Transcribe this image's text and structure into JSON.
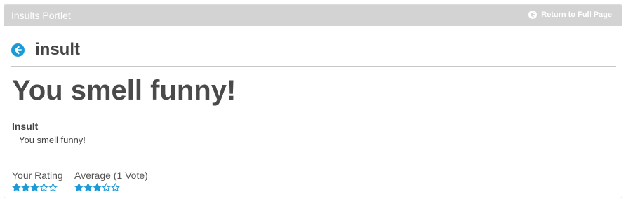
{
  "portlet": {
    "title": "Insults Portlet",
    "return_label": "Return to Full Page"
  },
  "header": {
    "title": "insult"
  },
  "entry": {
    "heading": "You smell funny!",
    "field_label": "Insult",
    "field_value": "You smell funny!"
  },
  "ratings": {
    "your_rating_label": "Your Rating",
    "your_rating_value": 3,
    "average_label": "Average (1 Vote)",
    "average_value": 3,
    "max_stars": 5
  },
  "colors": {
    "accent": "#1a9ad6",
    "topper": "#d3d3d3"
  },
  "icons": {
    "back": "arrow-circle-left-icon",
    "return": "arrow-circle-left-icon",
    "star_filled": "star-icon",
    "star_empty": "star-outline-icon"
  }
}
